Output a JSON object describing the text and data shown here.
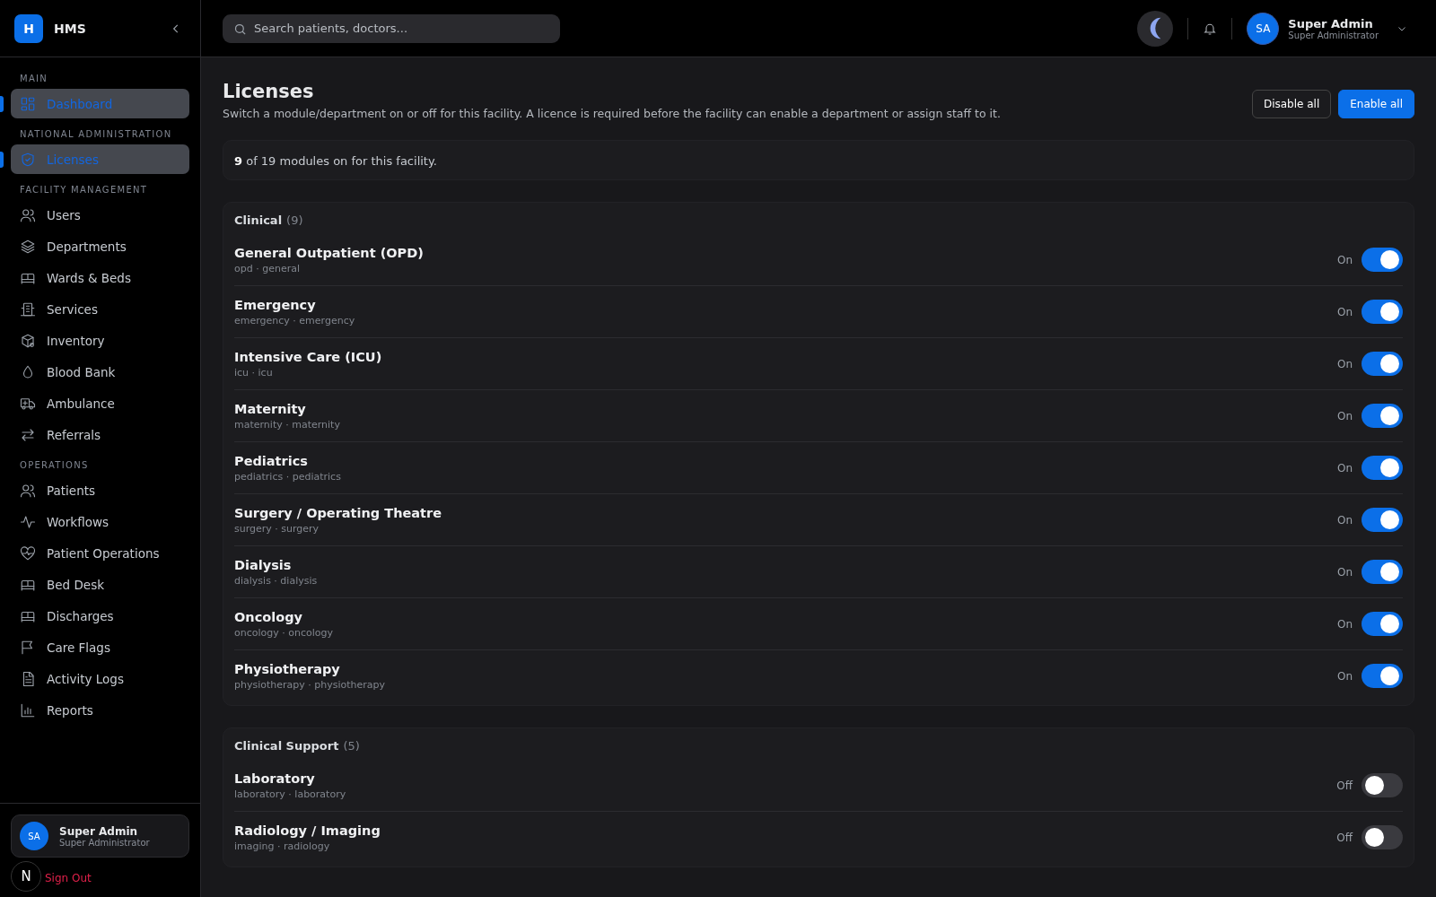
{
  "sidebar": {
    "logo": "H",
    "brand": "HMS",
    "sections": [
      {
        "title": "MAIN",
        "items": [
          {
            "label": "Dashboard",
            "selected": true
          }
        ]
      },
      {
        "title": "NATIONAL ADMINISTRATION",
        "items": [
          {
            "label": "Licenses",
            "selected": true
          }
        ]
      },
      {
        "title": "FACILITY MANAGEMENT",
        "items": [
          {
            "label": "Users",
            "selected": false
          },
          {
            "label": "Departments",
            "selected": false
          },
          {
            "label": "Wards & Beds",
            "selected": false
          },
          {
            "label": "Services",
            "selected": false
          },
          {
            "label": "Inventory",
            "selected": false
          },
          {
            "label": "Blood Bank",
            "selected": false
          },
          {
            "label": "Ambulance",
            "selected": false
          },
          {
            "label": "Referrals",
            "selected": false
          }
        ]
      },
      {
        "title": "OPERATIONS",
        "items": [
          {
            "label": "Patients",
            "selected": false
          },
          {
            "label": "Workflows",
            "selected": false
          },
          {
            "label": "Patient Operations",
            "selected": false
          },
          {
            "label": "Bed Desk",
            "selected": false
          },
          {
            "label": "Discharges",
            "selected": false
          },
          {
            "label": "Care Flags",
            "selected": false
          },
          {
            "label": "Activity Logs",
            "selected": false
          },
          {
            "label": "Reports",
            "selected": false
          }
        ]
      }
    ],
    "user": {
      "initials": "SA",
      "name": "Super Admin",
      "role": "Super Administrator"
    },
    "sign_out": "Sign Out",
    "dev_badge": "N"
  },
  "header": {
    "search": {
      "placeholder": "Search patients, doctors..."
    },
    "user": {
      "initials": "SA",
      "name": "Super Admin",
      "role": "Super Administrator"
    }
  },
  "page": {
    "title": "Licenses",
    "description": "Switch a module/department on or off for this facility. A licence is required before the facility can enable a department or assign staff to it.",
    "buttons": [
      {
        "label": "Disable all",
        "kind": "outline"
      },
      {
        "label": "Enable all",
        "kind": "primary"
      }
    ],
    "summary": "**9** of 19 modules on for this facility.",
    "groups": [
      {
        "name": "Clinical",
        "count": "(9)",
        "modules": [
          {
            "name": "General Outpatient (OPD)",
            "tags": "opd · general",
            "state_label": "On",
            "on": true
          },
          {
            "name": "Emergency",
            "tags": "emergency · emergency",
            "state_label": "On",
            "on": true
          },
          {
            "name": "Intensive Care (ICU)",
            "tags": "icu · icu",
            "state_label": "On",
            "on": true
          },
          {
            "name": "Maternity",
            "tags": "maternity · maternity",
            "state_label": "On",
            "on": true
          },
          {
            "name": "Pediatrics",
            "tags": "pediatrics · pediatrics",
            "state_label": "On",
            "on": true
          },
          {
            "name": "Surgery / Operating Theatre",
            "tags": "surgery · surgery",
            "state_label": "On",
            "on": true
          },
          {
            "name": "Dialysis",
            "tags": "dialysis · dialysis",
            "state_label": "On",
            "on": true
          },
          {
            "name": "Oncology",
            "tags": "oncology · oncology",
            "state_label": "On",
            "on": true
          },
          {
            "name": "Physiotherapy",
            "tags": "physiotherapy · physiotherapy",
            "state_label": "On",
            "on": true
          }
        ]
      },
      {
        "name": "Clinical Support",
        "count": "(5)",
        "modules": [
          {
            "name": "Laboratory",
            "tags": "laboratory · laboratory",
            "state_label": "Off",
            "on": false
          },
          {
            "name": "Radiology / Imaging",
            "tags": "imaging · radiology",
            "state_label": "Off",
            "on": false
          }
        ]
      }
    ]
  }
}
